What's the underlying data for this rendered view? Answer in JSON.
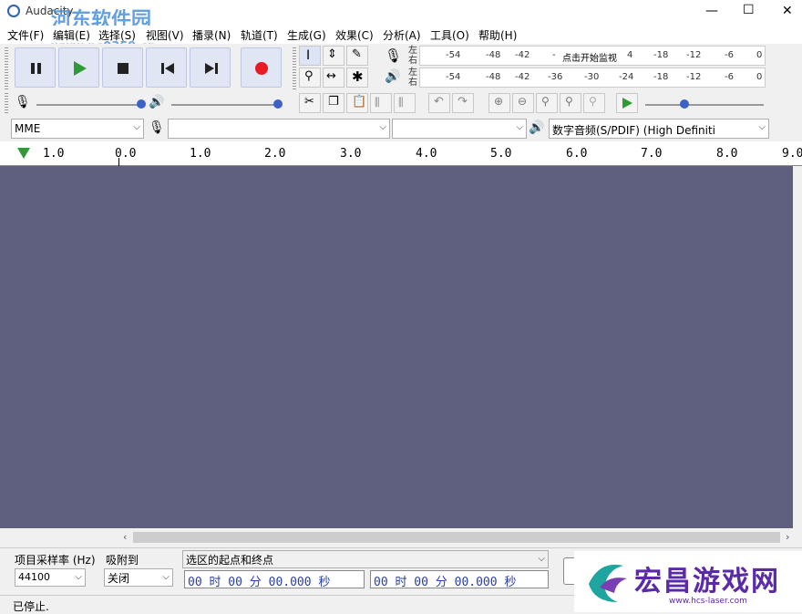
{
  "window": {
    "title": "Audacity",
    "min": "—",
    "max": "☐",
    "close": "✕"
  },
  "watermark": {
    "site": "河东软件园",
    "url": "www.pc0359.cn"
  },
  "menus": [
    "文件(F)",
    "编辑(E)",
    "选择(S)",
    "视图(V)",
    "播录(N)",
    "轨道(T)",
    "生成(G)",
    "效果(C)",
    "分析(A)",
    "工具(O)",
    "帮助(H)"
  ],
  "meters": {
    "rec_labels": [
      "-54",
      "-48",
      "-42",
      "-",
      "点击开始监视",
      "4",
      "-18",
      "-12",
      "-6",
      "0"
    ],
    "play_labels": [
      "-54",
      "-48",
      "-42",
      "-36",
      "-30",
      "-24",
      "-18",
      "-12",
      "-6",
      "0"
    ],
    "lr": [
      "左",
      "右"
    ]
  },
  "device": {
    "host": "MME",
    "input": "",
    "channels": "",
    "output": "数字音频(S/PDIF) (High Definiti"
  },
  "ruler": [
    "1.0",
    "0.0",
    "1.0",
    "2.0",
    "3.0",
    "4.0",
    "5.0",
    "6.0",
    "7.0",
    "8.0",
    "9.0"
  ],
  "selection": {
    "rate_label": "项目采样率 (Hz)",
    "rate": "44100",
    "snap_label": "吸附到",
    "snap": "关闭",
    "range_label": "选区的起点和终点",
    "start": "00 时 00 分 00.000 秒",
    "end": "00 时 00 分 00.000 秒"
  },
  "status": "已停止.",
  "badge": {
    "name": "宏昌游戏网",
    "url": "www.hcs-laser.com"
  },
  "colors": {
    "track_bg": "#5f6080",
    "record": "#e81b23",
    "play": "#2e9b34",
    "time_text": "#2a3ea8"
  }
}
